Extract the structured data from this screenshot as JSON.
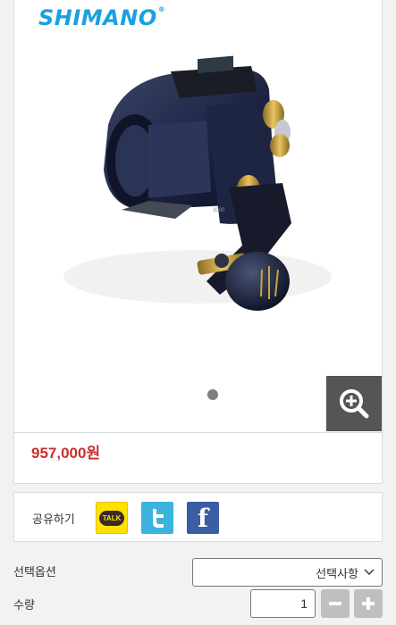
{
  "brand": {
    "logo_text": "SHIMANO",
    "logo_mark": "®",
    "color": "#1aa0e0"
  },
  "product": {
    "image_icon": "electric-fishing-reel-photo",
    "reel_model_marking": "3000",
    "price": "957,000원",
    "price_color": "#c9302c"
  },
  "carousel": {
    "total_slides": 1,
    "active_slide": 1
  },
  "share": {
    "label": "공유하기",
    "kakao_label": "TALK",
    "twitter_icon": "twitter-icon",
    "facebook_label": "f"
  },
  "options": {
    "label": "선택옵션",
    "selected": "선택사항",
    "chevron_icon": "chevron-down-icon"
  },
  "quantity": {
    "label": "수량",
    "value": "1",
    "minus_icon": "minus-icon",
    "plus_icon": "plus-icon"
  }
}
